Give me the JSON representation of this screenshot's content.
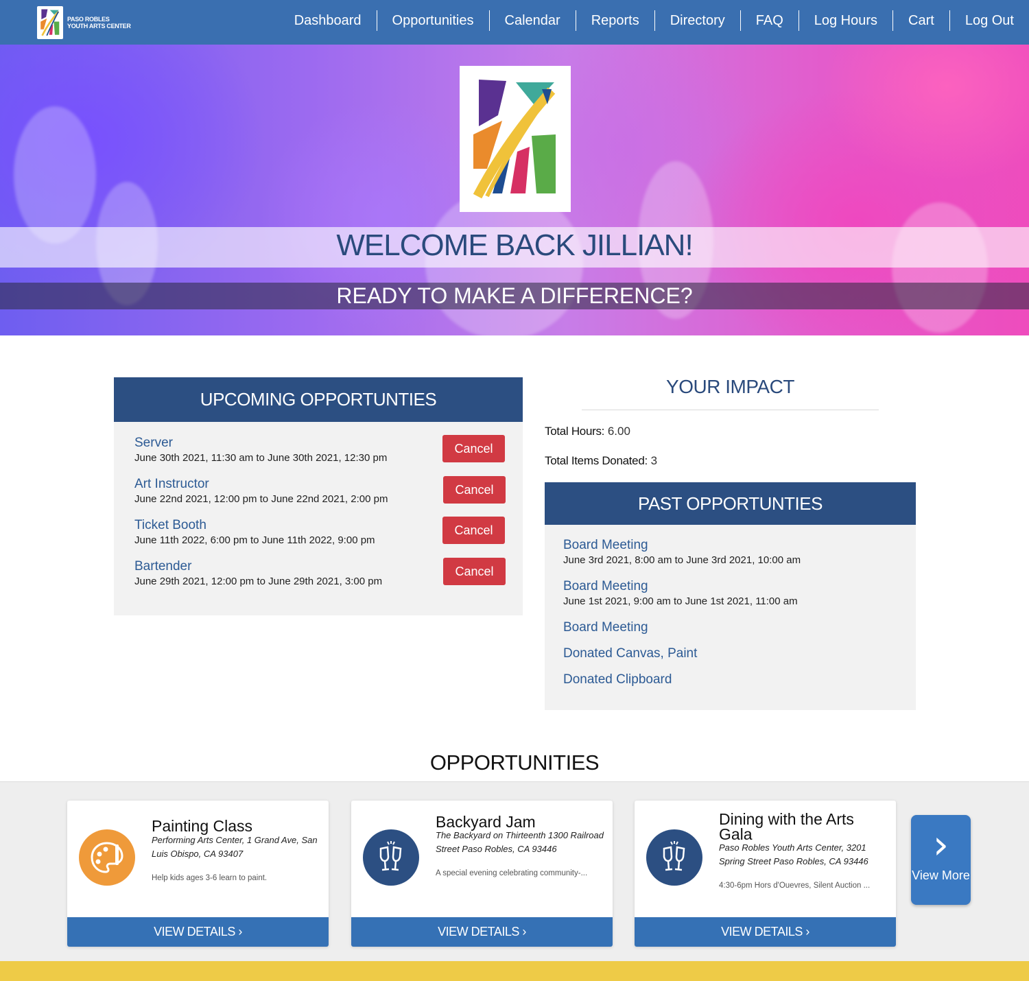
{
  "brand": {
    "name_line1": "PASO ROBLES",
    "name_line2": "YOUTH ARTS CENTER"
  },
  "nav": {
    "links": [
      "Dashboard",
      "Opportunities",
      "Calendar",
      "Reports",
      "Directory",
      "FAQ",
      "Log Hours",
      "Cart",
      "Log Out"
    ]
  },
  "hero": {
    "welcome": "WELCOME BACK JILLIAN!",
    "tagline": "READY TO MAKE A DIFFERENCE?"
  },
  "upcoming": {
    "title": "UPCOMING OPPORTUNTIES",
    "items": [
      {
        "title": "Server",
        "date": "June 30th 2021, 11:30 am to June 30th 2021, 12:30 pm",
        "action": "Cancel"
      },
      {
        "title": "Art Instructor",
        "date": "June 22nd 2021, 12:00 pm to June 22nd 2021, 2:00 pm",
        "action": "Cancel"
      },
      {
        "title": "Ticket Booth",
        "date": "June 11th 2022, 6:00 pm to June 11th 2022, 9:00 pm",
        "action": "Cancel"
      },
      {
        "title": "Bartender",
        "date": "June 29th 2021, 12:00 pm to June 29th 2021, 3:00 pm",
        "action": "Cancel"
      }
    ]
  },
  "impact": {
    "title": "YOUR IMPACT",
    "hours_label": "Total Hours:",
    "hours_value": "6.00",
    "items_label": "Total Items Donated:",
    "items_value": "3"
  },
  "past": {
    "title": "PAST OPPORTUNTIES",
    "items": [
      {
        "title": "Board Meeting",
        "date": "June 3rd 2021, 8:00 am to June 3rd 2021, 10:00 am"
      },
      {
        "title": "Board Meeting",
        "date": "June 1st 2021, 9:00 am to June 1st 2021, 11:00 am"
      },
      {
        "title": "Board Meeting",
        "date": ""
      },
      {
        "title": "Donated Canvas, Paint",
        "date": ""
      },
      {
        "title": "Donated Clipboard",
        "date": ""
      }
    ]
  },
  "opportunities": {
    "title": "OPPORTUNITIES",
    "cards": [
      {
        "title": "Painting Class",
        "address": "Performing Arts Center, 1 Grand Ave, San Luis Obispo, CA 93407",
        "description": "Help kids ages 3-6 learn to paint.",
        "button": "VIEW DETAILS ›",
        "icon": "palette-icon",
        "icon_color": "#ef9a3a"
      },
      {
        "title": "Backyard Jam",
        "address": "The Backyard on Thirteenth 1300 Railroad Street Paso Robles, CA 93446",
        "description": "A special evening celebrating community-...",
        "button": "VIEW DETAILS ›",
        "icon": "champagne-icon",
        "icon_color": "#2c4f82"
      },
      {
        "title": "Dining with the Arts Gala",
        "address": "Paso Robles Youth Arts Center, 3201 Spring Street Paso Robles, CA 93446",
        "description": "4:30-6pm Hors d'Ouevres, Silent Auction ...",
        "button": "VIEW DETAILS ›",
        "icon": "champagne-icon",
        "icon_color": "#2c4f82"
      }
    ],
    "view_more": "View More"
  },
  "colors": {
    "nav": "#3a6fb0",
    "panel_header": "#2c4f82",
    "cancel": "#d13a43",
    "card_button": "#3571b5",
    "footer": "#eecb47"
  }
}
